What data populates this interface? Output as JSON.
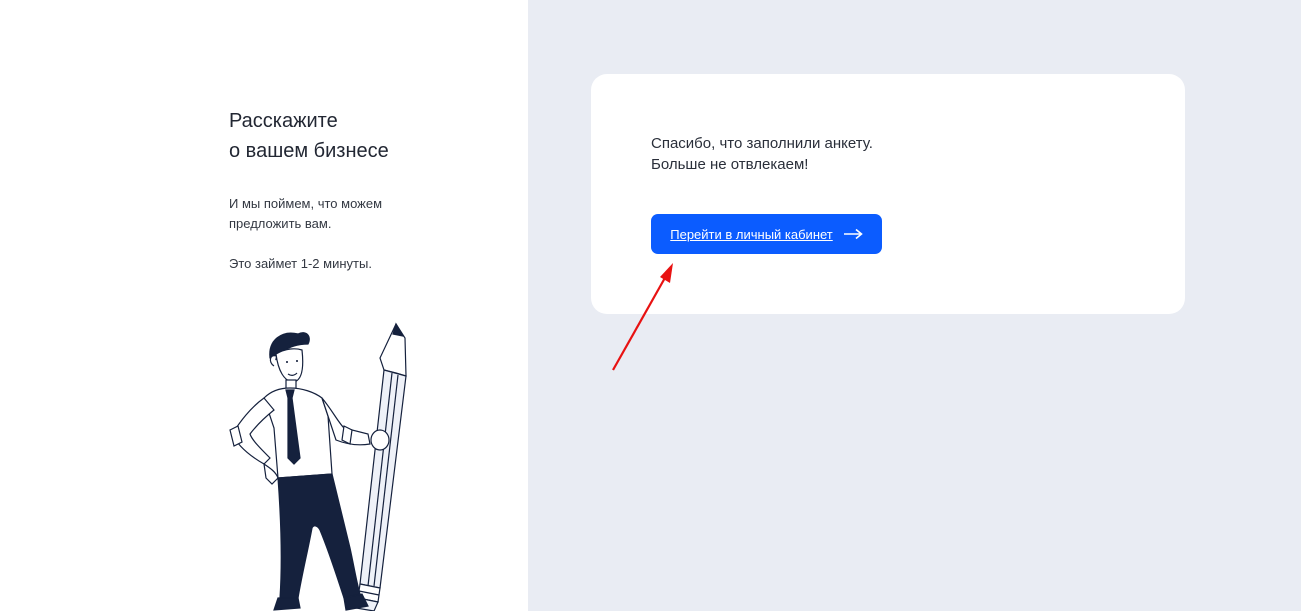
{
  "intro": {
    "title_line1": "Расскажите",
    "title_line2": "о вашем бизнесе",
    "text1_line1": "И мы поймем, что можем",
    "text1_line2": "предложить вам.",
    "text2": "Это займет 1-2 минуты."
  },
  "card": {
    "message_line1": "Спасибо, что заполнили анкету.",
    "message_line2": "Больше не отвлекаем!",
    "button_label": "Перейти в личный кабинет",
    "button_icon": "arrow-right-icon"
  },
  "colors": {
    "left_background": "#ffffff",
    "right_background": "#e9ecf3",
    "card_background": "#ffffff",
    "button_background": "#0b5cff",
    "annotation_arrow": "#e81212",
    "illustration_dark": "#15213d"
  }
}
